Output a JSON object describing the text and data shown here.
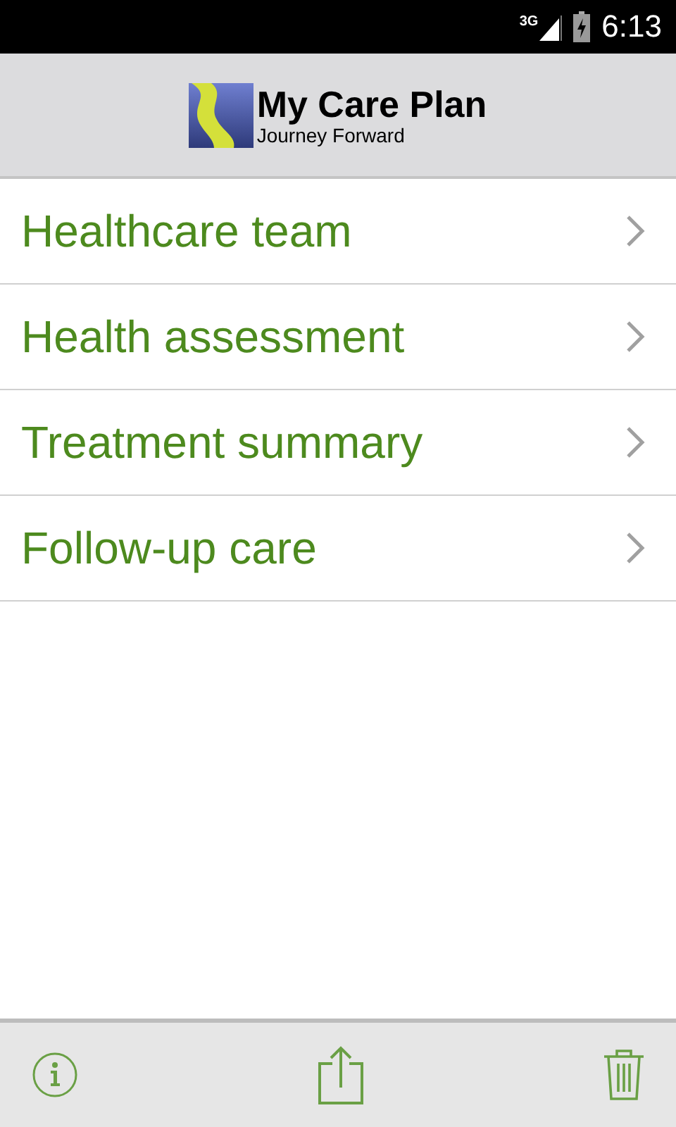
{
  "status_bar": {
    "network": "3G",
    "time": "6:13"
  },
  "header": {
    "title": "My Care Plan",
    "subtitle": "Journey Forward"
  },
  "menu": [
    {
      "label": "Healthcare team"
    },
    {
      "label": "Health assessment"
    },
    {
      "label": "Treatment summary"
    },
    {
      "label": "Follow-up care"
    }
  ]
}
